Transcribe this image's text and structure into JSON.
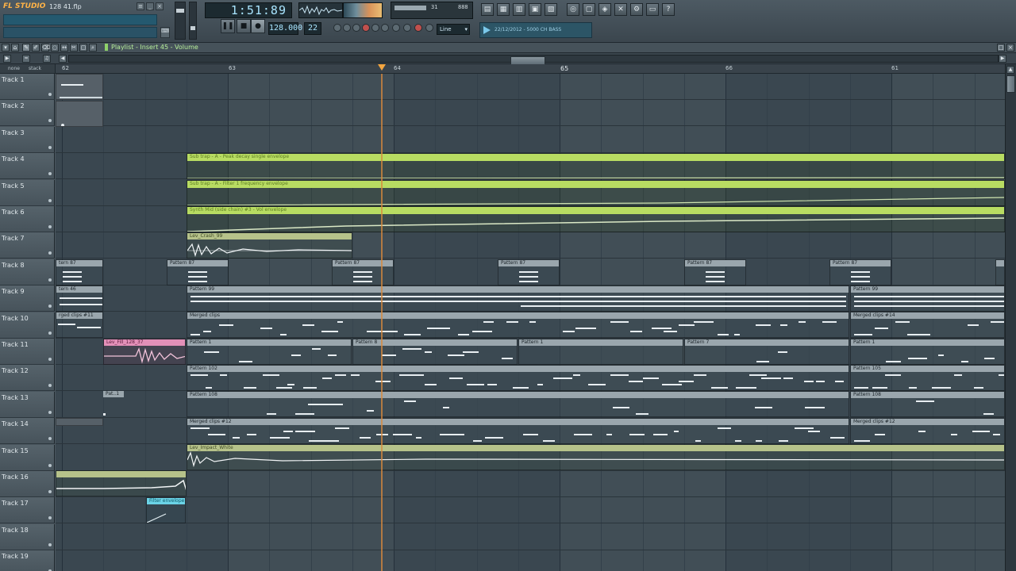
{
  "app": {
    "logo": "FL STUDIO",
    "project_name": "128 41.flp",
    "hint": "",
    "time_display": "1:51:89",
    "tempo": "128.000",
    "pattern_number": "22",
    "snap": "Line",
    "browser_text": "22/12/2012 - 5000 CH BASS",
    "cpu_label": "31",
    "mem_label": "888"
  },
  "playlist": {
    "title": "Playlist - Insert 45 - Volume",
    "ruler_left": [
      "none",
      "stack"
    ],
    "bars": [
      {
        "label": "62",
        "big": false
      },
      {
        "label": "63",
        "big": false
      },
      {
        "label": "64",
        "big": false
      },
      {
        "label": "65",
        "big": true
      },
      {
        "label": "66",
        "big": false
      },
      {
        "label": "61",
        "big": false
      }
    ],
    "tracks": [
      "Track 1",
      "Track 2",
      "Track 3",
      "Track 4",
      "Track 5",
      "Track 6",
      "Track 7",
      "Track 8",
      "Track 9",
      "Track 10",
      "Track 11",
      "Track 12",
      "Track 13",
      "Track 14",
      "Track 15",
      "Track 16",
      "Track 17",
      "Track 18",
      "Track 19"
    ],
    "clips": {
      "t4": "Sub trap - A - Peak decay single envelope",
      "t5": "Sub trap - A - Filter 1 frequency envelope",
      "t6": "Synth Mid (side chain) #3 - Vol envelope",
      "t7": "Lev_Crash_99",
      "t8a": "tern 87",
      "t8b": "Pattern 87",
      "t8c": "Pattern 87",
      "t8d": "Pattern 87",
      "t8e": "Pattern 87",
      "t8f": "Pattern 87",
      "t9a": "tern 46",
      "t9b": "Pattern 99",
      "t9c": "Pattern 99",
      "t10a": "rged clips #11",
      "t10b": "Merged clips",
      "t10c": "Merged clips #14",
      "t11a": "Lev_Fill_128_37",
      "t11b": "Pattern 1",
      "t11c": "Pattern 8",
      "t11d": "Pattern 1",
      "t11e": "Pattern 7",
      "t11f": "Pattern 1",
      "t12a": "Pattern 102",
      "t12b": "Pattern 105",
      "t13a": "Pat..1",
      "t13b": "Pattern 108",
      "t13c": "Pattern 108",
      "t14a": "Merged clips #12",
      "t14b": "Merged clips #12",
      "t15": "Lev_Impact_White",
      "t17": "Filter envelope"
    }
  },
  "colors": {
    "automation": "#b8dc62",
    "audio": "#b6c28a",
    "pattern": "#9aa6ad",
    "pink": "#e390b8",
    "cyan": "#6bd3e6",
    "playhead": "#f4a641"
  }
}
